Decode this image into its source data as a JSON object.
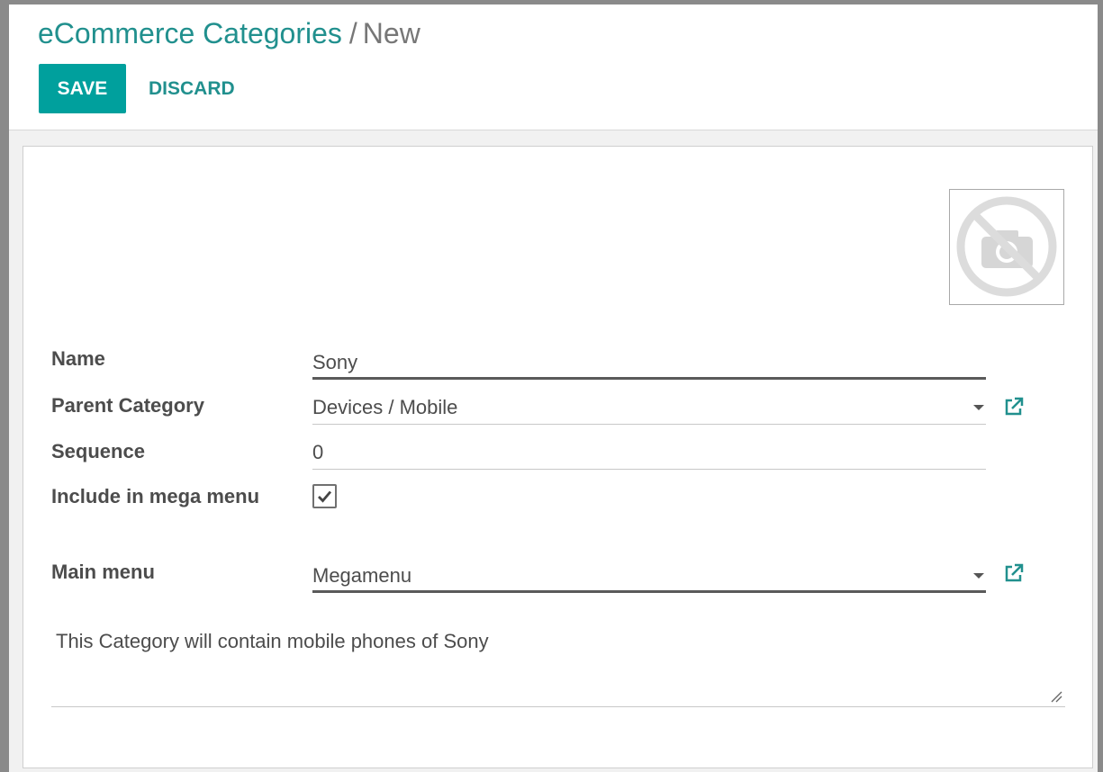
{
  "breadcrumb": {
    "parent": "eCommerce Categories",
    "separator": "/",
    "current": "New"
  },
  "toolbar": {
    "save_label": "SAVE",
    "discard_label": "DISCARD"
  },
  "colors": {
    "accent": "#00a09d",
    "link": "#21908e",
    "text": "#4c4c4c"
  },
  "form": {
    "image": {
      "icon": "no-photo-camera-icon"
    },
    "name": {
      "label": "Name",
      "value": "Sony"
    },
    "parent_category": {
      "label": "Parent Category",
      "value": "Devices / Mobile",
      "icon": "external-link-icon"
    },
    "sequence": {
      "label": "Sequence",
      "value": "0"
    },
    "include_in_mega_menu": {
      "label": "Include in mega menu",
      "checked": true
    },
    "main_menu": {
      "label": "Main menu",
      "value": "Megamenu",
      "icon": "external-link-icon"
    },
    "description": {
      "value": "This Category will contain mobile phones of Sony"
    }
  }
}
